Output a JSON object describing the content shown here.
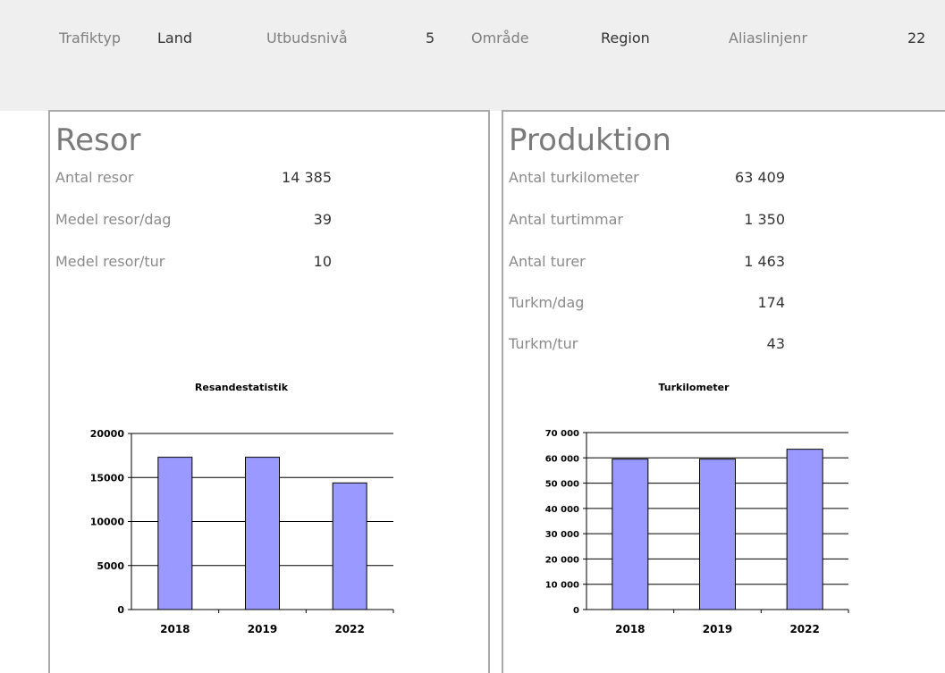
{
  "header": {
    "trafiktyp_label": "Trafiktyp",
    "trafiktyp_value": "Land",
    "utbudsniva_label": "Utbudsnivå",
    "utbudsniva_value": "5",
    "omrade_label": "Område",
    "omrade_value": "Region",
    "aliaslinjenr_label": "Aliaslinjenr",
    "aliaslinjenr_value": "22"
  },
  "resor": {
    "title": "Resor",
    "stats": [
      {
        "label": "Antal resor",
        "value": "14 385"
      },
      {
        "label": "Medel resor/dag",
        "value": "39"
      },
      {
        "label": "Medel resor/tur",
        "value": "10"
      }
    ]
  },
  "produktion": {
    "title": "Produktion",
    "stats": [
      {
        "label": "Antal turkilometer",
        "value": "63 409"
      },
      {
        "label": "Antal turtimmar",
        "value": "1 350"
      },
      {
        "label": "Antal turer",
        "value": "1 463"
      },
      {
        "label": "Turkm/dag",
        "value": "174"
      },
      {
        "label": "Turkm/tur",
        "value": "43"
      }
    ]
  },
  "colors": {
    "bar_fill": "#9999ff",
    "bar_stroke": "#000000",
    "header_bg": "#efefef"
  },
  "chart_data": [
    {
      "type": "bar",
      "title": "Resandestatistik",
      "categories": [
        "2018",
        "2019",
        "2022"
      ],
      "values": [
        17300,
        17300,
        14385
      ],
      "ylim": [
        0,
        20000
      ],
      "yticks": [
        0,
        5000,
        10000,
        15000,
        20000
      ],
      "ytick_labels": [
        "0",
        "5000",
        "10000",
        "15000",
        "20000"
      ],
      "xlabel": "",
      "ylabel": "",
      "grid": true
    },
    {
      "type": "bar",
      "title": "Turkilometer",
      "categories": [
        "2018",
        "2019",
        "2022"
      ],
      "values": [
        59500,
        59500,
        63409
      ],
      "ylim": [
        0,
        70000
      ],
      "yticks": [
        0,
        10000,
        20000,
        30000,
        40000,
        50000,
        60000,
        70000
      ],
      "ytick_labels": [
        "0",
        "10 000",
        "20 000",
        "30 000",
        "40 000",
        "50 000",
        "60 000",
        "70 000"
      ],
      "xlabel": "",
      "ylabel": "",
      "grid": true
    }
  ]
}
